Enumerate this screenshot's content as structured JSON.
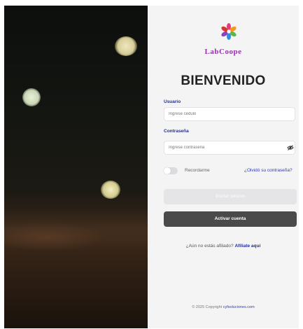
{
  "brand": {
    "name": "LabCoope"
  },
  "login": {
    "title": "BIENVENIDO",
    "username_label": "Usuario",
    "username_placeholder": "Ingrese cédulo",
    "password_label": "Contraseña",
    "password_placeholder": "Ingrese contraseña",
    "remember_label": "Recordarme",
    "forgot_link": "¿Olvidó su contraseña?",
    "login_button": "Iniciar sesión",
    "activate_button": "Activar cuenta",
    "affiliate_question": "¿Aún no estás afiliado?",
    "affiliate_link": "Afíliate aquí"
  },
  "footer": {
    "copyright_prefix": "© 2025 Copyright",
    "copyright_link": "cyfsoluciones.com"
  },
  "icons": {
    "logo": "flower-logo-icon",
    "password_toggle": "eye-icon"
  },
  "colors": {
    "accent": "#1f2fa0",
    "brand": "#9a2db0",
    "primary_button": "#4a4a4a",
    "disabled_button": "#e5e5e7"
  },
  "state": {
    "remember_me": false
  }
}
